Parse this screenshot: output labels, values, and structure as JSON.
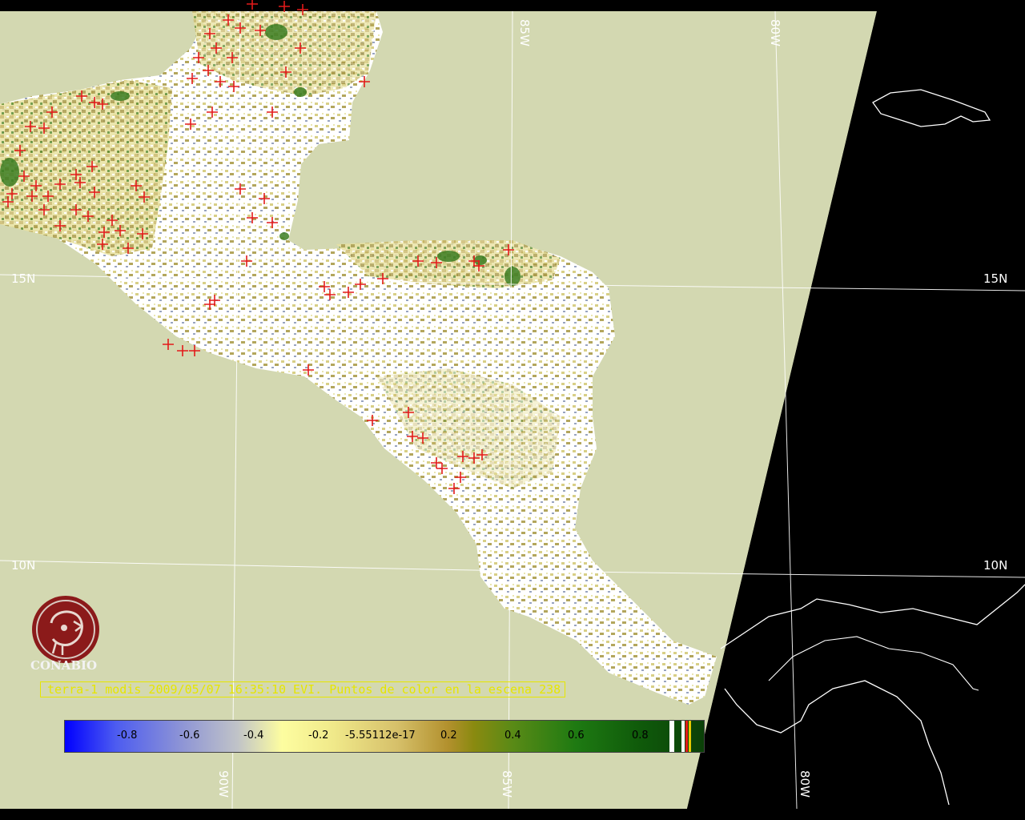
{
  "grid": {
    "lat_labels": [
      "15N",
      "10N"
    ],
    "lon_labels": [
      "80W",
      "85W",
      "90W"
    ]
  },
  "caption": "terra-1 modis 2009/05/07 16:35:10 EVI. Puntos de color en la escena 238",
  "logo": {
    "name": "CONABIO"
  },
  "colorbar": {
    "ticks": [
      "-0.8",
      "-0.6",
      "-0.4",
      "-0.2",
      "-5.55112e-17",
      "0.2",
      "0.4",
      "0.6",
      "0.8"
    ]
  },
  "colors": {
    "ocean": "#d3d8b1",
    "nodata": "#000000",
    "land_bright": "#ffffff",
    "fire_marker": "#e31a1a",
    "caption": "#e6e600"
  }
}
